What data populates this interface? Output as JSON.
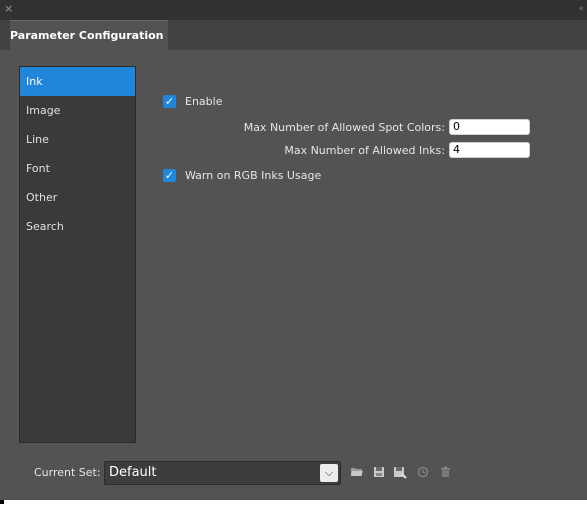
{
  "window": {
    "close_glyph": "×",
    "tab_label": "Parameter Configuration"
  },
  "sidebar": {
    "items": [
      {
        "label": "Ink",
        "active": true
      },
      {
        "label": "Image",
        "active": false
      },
      {
        "label": "Line",
        "active": false
      },
      {
        "label": "Font",
        "active": false
      },
      {
        "label": "Other",
        "active": false
      },
      {
        "label": "Search",
        "active": false
      }
    ]
  },
  "ink": {
    "enable": {
      "label": "Enable",
      "checked": true
    },
    "max_spot_colors": {
      "label": "Max Number of Allowed Spot Colors:",
      "value": "0"
    },
    "max_inks": {
      "label": "Max Number of Allowed Inks:",
      "value": "4"
    },
    "warn_rgb": {
      "label": "Warn on RGB Inks Usage",
      "checked": true
    }
  },
  "footer": {
    "current_set_label": "Current Set:",
    "current_set_value": "Default",
    "icons": [
      "folder-open-icon",
      "save-icon",
      "save-as-icon",
      "history-icon",
      "trash-icon"
    ]
  },
  "colors": {
    "accent": "#1f86d9",
    "panel": "#535353",
    "sidebar": "#3a3a3a"
  }
}
